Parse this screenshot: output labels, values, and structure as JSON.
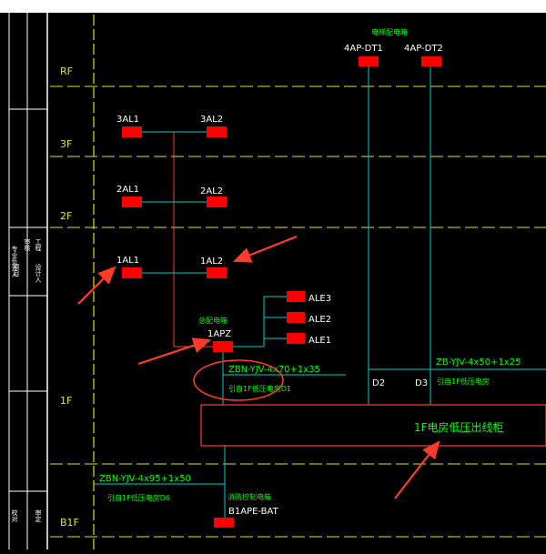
{
  "floors": {
    "rf": "RF",
    "f3": "3F",
    "f2": "2F",
    "f1": "1F",
    "b1f": "B1F"
  },
  "title_block": {
    "cells": [
      "专业负责人",
      "审核",
      "工程",
      "项目",
      "设计人",
      "校对",
      "审定"
    ]
  },
  "panels": {
    "p3al1": "3AL1",
    "p3al2": "3AL2",
    "p2al1": "2AL1",
    "p2al2": "2AL2",
    "p1al1": "1AL1",
    "p1al2": "1AL2",
    "apz_label": "1APZ",
    "apz_note": "总配电箱",
    "dt1": "4AP-DT1",
    "dt2": "4AP-DT2",
    "elevator_note": "电梯配电箱",
    "fire_note": "消防控制电箱",
    "bat": "B1APE-BAT"
  },
  "lighting": {
    "ale3": "ALE3",
    "ale2": "ALE2",
    "ale1": "ALE1"
  },
  "cables": {
    "zbn_70": "ZBN-YJV-4x70+1x35",
    "zbn_70_src": "引自1F低压电房D1",
    "zb_50": "ZB-YJV-4x50+1x25",
    "zb_50_src": "引自1F低压电房",
    "zbn_95": "ZBN-YJV-4x95+1x50",
    "zbn_95_src": "引自1F低压电房D6",
    "d2": "D2",
    "d3": "D3"
  },
  "switchboard": {
    "label": "1F电房低压出线柜"
  },
  "colors": {
    "background": "#000000",
    "floor_line": "#e6e600",
    "panel": "#ff0000",
    "wire": "#00cccc",
    "riser": "#ff3b3b",
    "text": "#ffffff",
    "label": "#00ff00",
    "arrow": "#ff3b2b"
  }
}
